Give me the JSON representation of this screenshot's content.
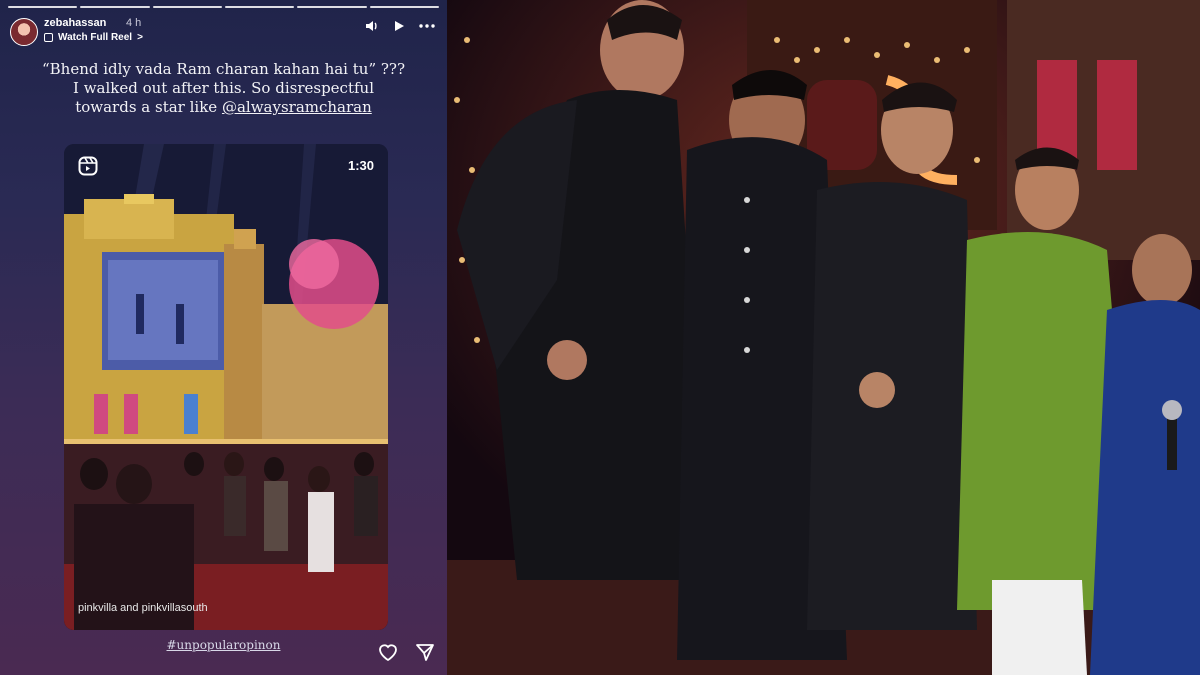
{
  "story": {
    "progress_segments": 6,
    "username": "zebahassan",
    "time_ago": "4 h",
    "reel_link_label": "Watch Full Reel",
    "reel_link_chevron": ">",
    "caption_line1": "“Bhend idly vada Ram charan kahan hai tu” ???",
    "caption_line2": "I walked out after this. So disrespectful",
    "caption_line3_prefix": "towards a star like ",
    "caption_mention": "@alwaysramcharan",
    "reel": {
      "duration": "1:30",
      "watermark": "pinkvilla and pinkvillasouth"
    },
    "hashtag": "#unpopularopinon",
    "icons": {
      "volume": "volume-icon",
      "play": "play-icon",
      "more": "more-icon",
      "reel": "reel-icon",
      "like": "heart-icon",
      "share": "send-icon"
    }
  },
  "colors": {
    "story_bg_top": "#20244a",
    "story_bg_bottom": "#4a2a52",
    "kurta_green": "#6e9a2e",
    "sherwani_black": "#141418",
    "sherwani_blue": "#1f3a8a"
  }
}
